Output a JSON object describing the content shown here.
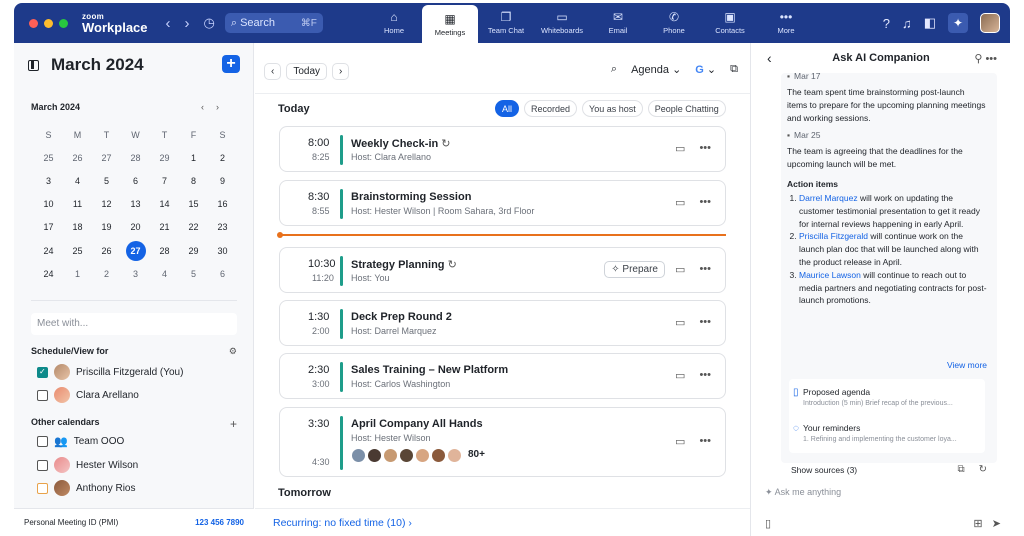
{
  "colors": {
    "topbar": "#1e3a8a",
    "accent": "#1463e5",
    "event_bar": "#1e9d8a",
    "now_line": "#e8711c"
  },
  "app": {
    "brand_small": "zoom",
    "brand_big": "Workplace"
  },
  "search": {
    "placeholder": "Search",
    "shortcut": "⌘F"
  },
  "tabs": [
    {
      "label": "Home",
      "icon": "home-icon"
    },
    {
      "label": "Meetings",
      "icon": "calendar-icon"
    },
    {
      "label": "Team Chat",
      "icon": "chat-icon"
    },
    {
      "label": "Whiteboards",
      "icon": "whiteboard-icon"
    },
    {
      "label": "Email",
      "icon": "email-icon"
    },
    {
      "label": "Phone",
      "icon": "phone-icon"
    },
    {
      "label": "Contacts",
      "icon": "contacts-icon"
    },
    {
      "label": "More",
      "icon": "more-icon"
    }
  ],
  "sidebar": {
    "month_title": "March 2024",
    "mini_month": "March  2024",
    "weekdays": [
      "S",
      "M",
      "T",
      "W",
      "T",
      "F",
      "S"
    ],
    "weeks": [
      [
        "25",
        "26",
        "27",
        "28",
        "29",
        "1",
        "2"
      ],
      [
        "3",
        "4",
        "5",
        "6",
        "7",
        "8",
        "9"
      ],
      [
        "10",
        "11",
        "12",
        "13",
        "14",
        "15",
        "16"
      ],
      [
        "17",
        "18",
        "19",
        "20",
        "21",
        "22",
        "23"
      ],
      [
        "24",
        "25",
        "26",
        "27",
        "28",
        "29",
        "30"
      ],
      [
        "24",
        "1",
        "2",
        "3",
        "4",
        "5",
        "6"
      ]
    ],
    "selected_day": "27",
    "meet_with_placeholder": "Meet with...",
    "schedule_heading": "Schedule/View for",
    "schedule_people": [
      {
        "name": "Priscilla Fitzgerald (You)",
        "checked": true
      },
      {
        "name": "Clara Arellano",
        "checked": false
      }
    ],
    "other_heading": "Other calendars",
    "other_calendars": [
      {
        "name": "Team OOO",
        "type": "group"
      },
      {
        "name": "Hester Wilson",
        "type": "person"
      },
      {
        "name": "Anthony Rios",
        "type": "person"
      }
    ],
    "pmi_label": "Personal Meeting ID (PMI)",
    "pmi_value": "123 456 7890"
  },
  "center": {
    "today_btn": "Today",
    "view": "Agenda",
    "google_label": "G",
    "day_label": "Today",
    "filters": [
      "All",
      "Recorded",
      "You as host",
      "People Chatting"
    ],
    "events": [
      {
        "start": "8:00",
        "end": "8:25",
        "title": "Weekly Check-in",
        "host": "Host: Clara Arellano",
        "recurring": true
      },
      {
        "start": "8:30",
        "end": "8:55",
        "title": "Brainstorming Session",
        "host": "Host: Hester Wilson  |  Room Sahara, 3rd Floor",
        "recurring": false
      },
      {
        "start": "10:30",
        "end": "11:20",
        "title": "Strategy Planning",
        "host": "Host: You",
        "recurring": true,
        "prepare": "Prepare"
      },
      {
        "start": "1:30",
        "end": "2:00",
        "title": "Deck Prep Round 2",
        "host": "Host: Darrel Marquez",
        "recurring": false
      },
      {
        "start": "2:30",
        "end": "3:00",
        "title": "Sales Training – New Platform",
        "host": "Host: Carlos Washington",
        "recurring": false
      },
      {
        "start": "3:30",
        "end": "4:30",
        "title": "April Company All Hands",
        "host": "Host: Hester Wilson",
        "recurring": false,
        "attendees_more": "80+"
      }
    ],
    "tomorrow_label": "Tomorrow",
    "recurring_link": "Recurring: no fixed time (10)"
  },
  "assistant": {
    "title": "Ask AI Companion",
    "date1": "Mar 17",
    "text1": "The team spent time brainstorming post-launch items to prepare for the upcoming planning meetings and working sessions.",
    "date2": "Mar 25",
    "text2": "The team is agreeing that the deadlines for the upcoming launch will be met.",
    "action_heading": "Action items",
    "actions": [
      {
        "name": "Darrel Marquez",
        "text": " will work on updating the customer testimonial presentation to get it ready for internal reviews happening in early April."
      },
      {
        "name": "Priscilla Fitzgerald",
        "text": " will continue work on the launch plan doc that will be launched along with the product release in April."
      },
      {
        "name": "Maurice Lawson",
        "text": " will continue to reach out to media partners and negotiating contracts for post-launch promotions."
      }
    ],
    "view_more": "View more",
    "sources": [
      {
        "title": "Proposed agenda",
        "snippet": "Introduction (5 min) Brief recap of the previous..."
      },
      {
        "title": "Your reminders",
        "snippet": "1. Refining and implementing the customer loya..."
      }
    ],
    "show_sources": "Show sources (3)",
    "ask_placeholder": "Ask me anything"
  }
}
